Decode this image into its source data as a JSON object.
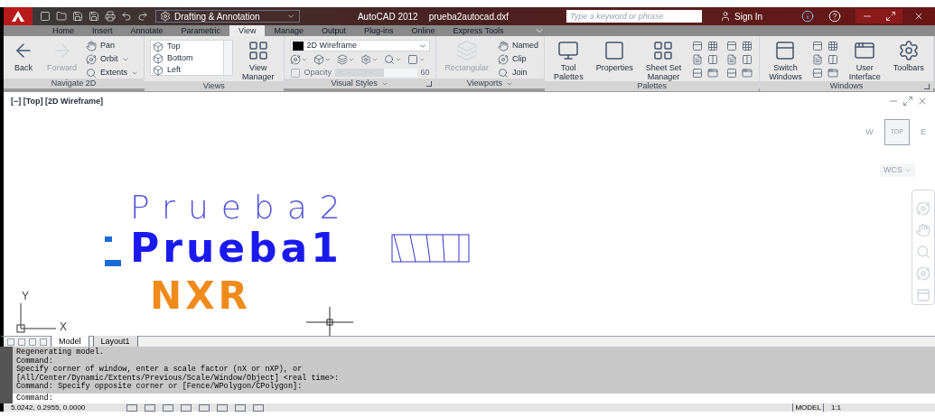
{
  "title_bar": {
    "workspace": "Drafting & Annotation",
    "app": "AutoCAD 2012",
    "file": "prueba2autocad.dxf",
    "search": {
      "placeholder": "Type a keyword or phrase"
    },
    "sign_in": "Sign In"
  },
  "tabs": [
    {
      "label": "Home",
      "selected": false
    },
    {
      "label": "Insert",
      "selected": false
    },
    {
      "label": "Annotate",
      "selected": false
    },
    {
      "label": "Parametric",
      "selected": false
    },
    {
      "label": "View",
      "selected": true
    },
    {
      "label": "Manage",
      "selected": false
    },
    {
      "label": "Output",
      "selected": false
    },
    {
      "label": "Plug-ins",
      "selected": false
    },
    {
      "label": "Online",
      "selected": false
    },
    {
      "label": "Express Tools",
      "selected": false
    }
  ],
  "panels": [
    {
      "title": "Navigate 2D",
      "menu": false,
      "launcher": false,
      "columns": [
        {
          "kind": "large",
          "label": "Back",
          "disabled": false
        },
        {
          "kind": "large",
          "label": "Forward",
          "disabled": true
        },
        {
          "kind": "smalls",
          "items": [
            {
              "label": "Pan",
              "dropdown": false
            },
            {
              "label": "Orbit",
              "dropdown": true
            },
            {
              "label": "Extents",
              "dropdown": true
            }
          ]
        }
      ]
    },
    {
      "title": "Views",
      "menu": false,
      "launcher": false,
      "columns": [
        {
          "kind": "list",
          "items": [
            "Top",
            "Bottom",
            "Left"
          ]
        },
        {
          "kind": "large",
          "label": "View\nManager",
          "disabled": false
        }
      ]
    },
    {
      "title": "Visual Styles",
      "menu": true,
      "launcher": true,
      "columns": [
        {
          "kind": "style",
          "value": "2D Wireframe",
          "opacity": "Opacity",
          "amount": "60",
          "level": 0.6
        }
      ]
    },
    {
      "title": "Viewports",
      "menu": true,
      "launcher": false,
      "columns": [
        {
          "kind": "large",
          "label": "Rectangular",
          "disabled": true
        },
        {
          "kind": "smalls",
          "items": [
            {
              "label": "Named",
              "dropdown": false
            },
            {
              "label": "Clip",
              "dropdown": false
            },
            {
              "label": "Join",
              "dropdown": false
            }
          ]
        }
      ]
    },
    {
      "title": "Palettes",
      "menu": false,
      "launcher": false,
      "columns": [
        {
          "kind": "large",
          "label": "Tool\nPalettes",
          "disabled": false
        },
        {
          "kind": "large",
          "label": "Properties",
          "disabled": false
        },
        {
          "kind": "large",
          "label": "Sheet Set\nManager",
          "disabled": false
        },
        {
          "kind": "icons"
        },
        {
          "kind": "icons"
        }
      ]
    },
    {
      "title": "Windows",
      "menu": false,
      "launcher": true,
      "columns": [
        {
          "kind": "large",
          "label": "Switch\nWindows",
          "disabled": false
        },
        {
          "kind": "icons"
        },
        {
          "kind": "large",
          "label": "User\nInterface",
          "disabled": false
        },
        {
          "kind": "large",
          "label": "Toolbars",
          "disabled": false
        }
      ]
    }
  ],
  "viewport": {
    "label": "[−] [Top] [2D Wireframe]",
    "cube": {
      "face": "TOP",
      "west": "W",
      "east": "E",
      "ucs": "WCS"
    },
    "drawing": [
      {
        "text": "Prueba2",
        "color": "#5555dd",
        "kind": "thin"
      },
      {
        "text": "Prueba1",
        "color": "#1a1aee",
        "kind": "bold"
      },
      {
        "text": "NXR",
        "color": "#f08a1a",
        "kind": "bold"
      }
    ],
    "axis_y": "Y",
    "axis_x": "X"
  },
  "layout_tabs": [
    {
      "label": "Model",
      "selected": true
    },
    {
      "label": "Layout1",
      "selected": false
    }
  ],
  "command_history": [
    "Regenerating model.",
    "Command:",
    "Specify corner of window, enter a scale factor (nX or nXP), or",
    "[All/Center/Dynamic/Extents/Previous/Scale/Window/Object] <real time>:",
    "Command: Specify opposite corner or [Fence/WPolygon/CPolygon]:"
  ],
  "command_line": "Command:",
  "status_bar": {
    "coordinates": "5.0242, 0.2955, 0.0000",
    "space": "MODEL",
    "scale": "1:1"
  }
}
